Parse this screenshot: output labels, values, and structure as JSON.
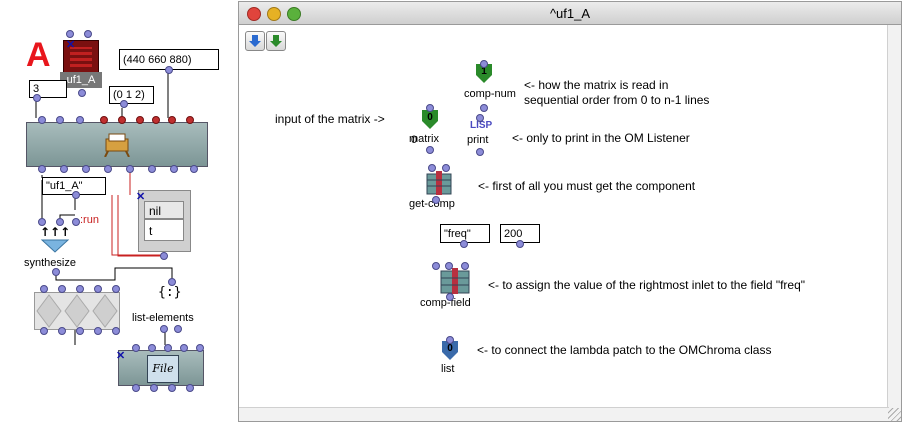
{
  "left_patch": {
    "big_letter": "A",
    "instance_name": "uf1_A",
    "list_440": "(440 660 880)",
    "num_3": "3",
    "list_012": "(0 1 2)",
    "string_uf1a": "\"uf1_A\"",
    "run_keyword": ":run",
    "menu_nil": "nil",
    "menu_t": "t",
    "synthesize_label": "synthesize",
    "list_elements_label": "list-elements"
  },
  "window": {
    "title": "^uf1_A",
    "comp_num_value": "1",
    "comp_num_label": "comp-num",
    "note_comp_num_1": "<- how the matrix is read in",
    "note_comp_num_2": "sequential order from 0 to n-1 lines",
    "input_note": "input of the matrix ->",
    "matrix_value": "0",
    "matrix_label": "matrix",
    "lisp_text": "LISP",
    "print_label": "print",
    "note_print": "<- only to print in the OM Listener",
    "get_comp_label": "get-comp",
    "note_get_comp": "<- first of all you must get the component",
    "freq_value": "\"freq\"",
    "val_200": "200",
    "comp_field_label": "comp-field",
    "note_comp_field": "<- to assign the value of the rightmost inlet to the field \"freq\"",
    "list_value": "0",
    "list_label": "list",
    "note_list": "<- to connect the lambda patch to the OMChroma class"
  },
  "colors": {
    "accent_red": "#e8161c",
    "inlet_blue": "#8c8cd8",
    "green_box": "#2a8a2a"
  }
}
